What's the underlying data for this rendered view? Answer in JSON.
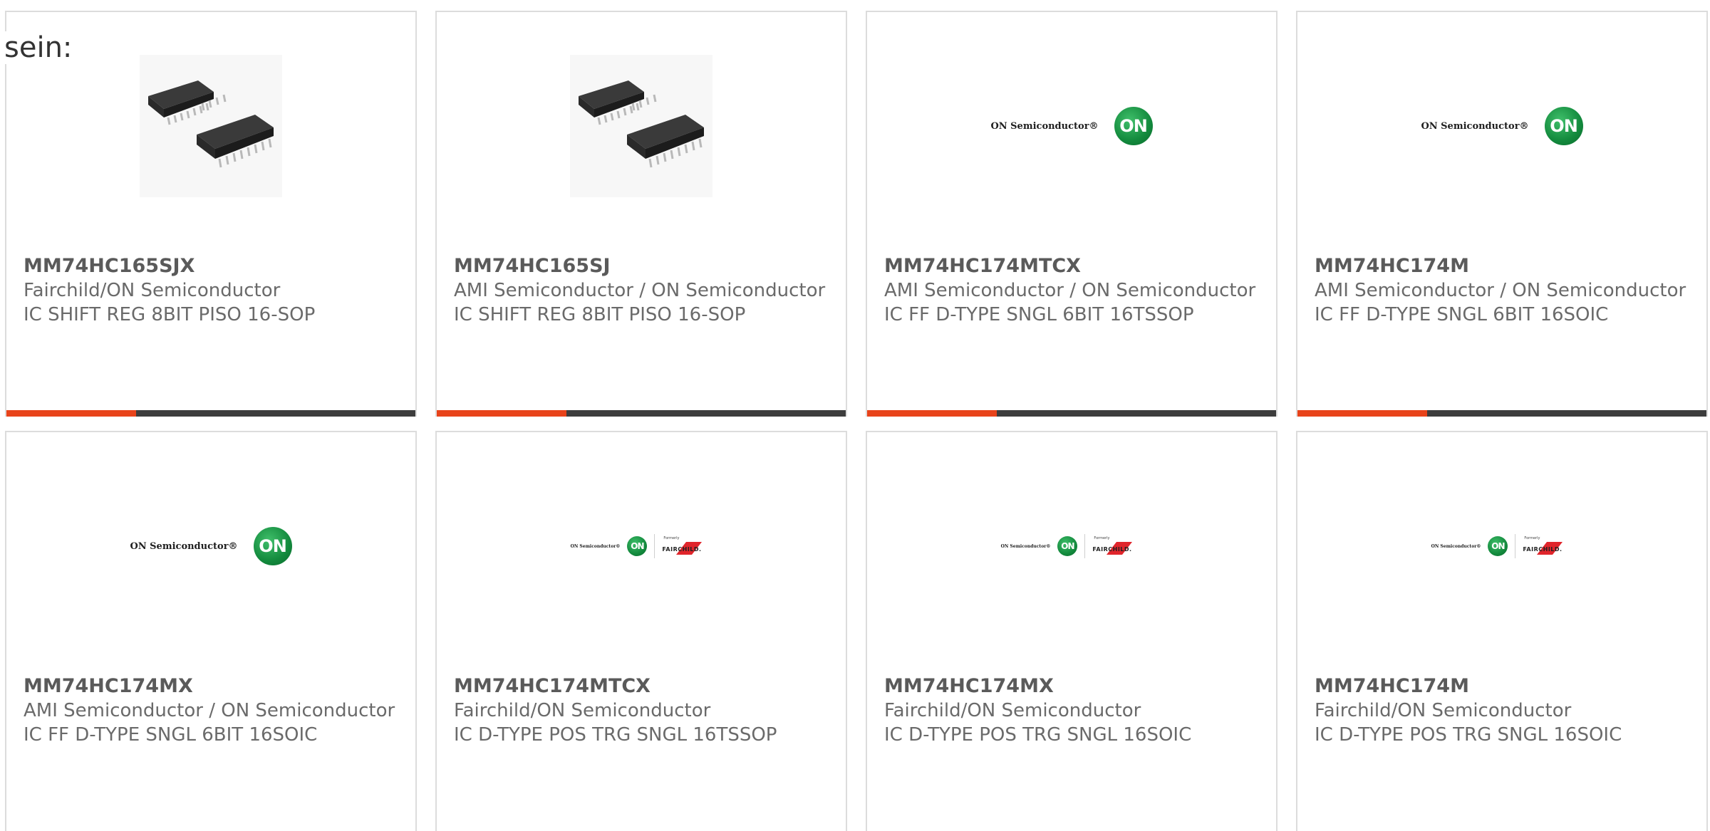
{
  "intro_text": "sein:",
  "colors": {
    "accent_bar": "#e8431a",
    "bar_dark": "#3d3d3d",
    "card_border": "#dcdcdc",
    "on_green": "#138a3d"
  },
  "logos": {
    "on_text": "ON Semiconductor®",
    "on_badge": "ON",
    "formerly": "Formerly",
    "fairchild": "FAIRCHILD."
  },
  "products": [
    {
      "part": "MM74HC165SJX",
      "manufacturer": "Fairchild/ON Semiconductor",
      "description": "IC SHIFT REG 8BIT PISO 16-SOP",
      "image": "chip-icon"
    },
    {
      "part": "MM74HC165SJ",
      "manufacturer": "AMI Semiconductor / ON Semiconductor",
      "description": "IC SHIFT REG 8BIT PISO 16-SOP",
      "image": "chip-icon"
    },
    {
      "part": "MM74HC174MTCX",
      "manufacturer": "AMI Semiconductor / ON Semiconductor",
      "description": "IC FF D-TYPE SNGL 6BIT 16TSSOP",
      "image": "on-semiconductor-logo"
    },
    {
      "part": "MM74HC174M",
      "manufacturer": "AMI Semiconductor / ON Semiconductor",
      "description": "IC FF D-TYPE SNGL 6BIT 16SOIC",
      "image": "on-semiconductor-logo"
    },
    {
      "part": "MM74HC174MX",
      "manufacturer": "AMI Semiconductor / ON Semiconductor",
      "description": "IC FF D-TYPE SNGL 6BIT 16SOIC",
      "image": "on-semiconductor-logo"
    },
    {
      "part": "MM74HC174MTCX",
      "manufacturer": "Fairchild/ON Semiconductor",
      "description": "IC D-TYPE POS TRG SNGL 16TSSOP",
      "image": "on-fairchild-logo"
    },
    {
      "part": "MM74HC174MX",
      "manufacturer": "Fairchild/ON Semiconductor",
      "description": "IC D-TYPE POS TRG SNGL 16SOIC",
      "image": "on-fairchild-logo"
    },
    {
      "part": "MM74HC174M",
      "manufacturer": "Fairchild/ON Semiconductor",
      "description": "IC D-TYPE POS TRG SNGL 16SOIC",
      "image": "on-fairchild-logo"
    }
  ]
}
